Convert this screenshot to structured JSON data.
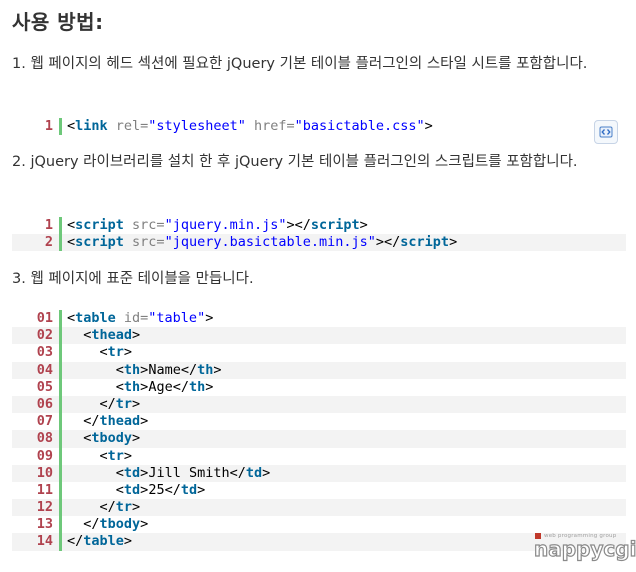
{
  "heading": "사용 방법:",
  "steps": [
    {
      "text": "1. 웹 페이지의 헤드 섹션에 필요한 jQuery 기본 테이블 플러그인의 스타일 시트를 포함합니다.",
      "lines": [
        {
          "num": "1",
          "tokens": [
            {
              "t": "<",
              "c": "tag-open"
            },
            {
              "t": "link",
              "c": "tagname"
            },
            {
              "t": " rel=",
              "c": "attr"
            },
            {
              "t": "\"stylesheet\"",
              "c": "str"
            },
            {
              "t": " href=",
              "c": "attr"
            },
            {
              "t": "\"basictable.css\"",
              "c": "str"
            },
            {
              "t": ">",
              "c": "tag-close"
            }
          ]
        }
      ]
    },
    {
      "text": "2. jQuery 라이브러리를 설치 한 후 jQuery 기본 테이블 플러그인의 스크립트를 포함합니다.",
      "lines": [
        {
          "num": "1",
          "tokens": [
            {
              "t": "<",
              "c": "tag-open"
            },
            {
              "t": "script",
              "c": "tagname"
            },
            {
              "t": " src=",
              "c": "attr"
            },
            {
              "t": "\"jquery.min.js\"",
              "c": "str"
            },
            {
              "t": "></",
              "c": "tag-close"
            },
            {
              "t": "script",
              "c": "tagname"
            },
            {
              "t": ">",
              "c": "tag-close"
            }
          ]
        },
        {
          "num": "2",
          "tokens": [
            {
              "t": "<",
              "c": "tag-open"
            },
            {
              "t": "script",
              "c": "tagname"
            },
            {
              "t": " src=",
              "c": "attr"
            },
            {
              "t": "\"jquery.basictable.min.js\"",
              "c": "str"
            },
            {
              "t": "></",
              "c": "tag-close"
            },
            {
              "t": "script",
              "c": "tagname"
            },
            {
              "t": ">",
              "c": "tag-close"
            }
          ]
        }
      ]
    },
    {
      "text": "3. 웹 페이지에 표준 테이블을 만듭니다.",
      "lines": [
        {
          "num": "01",
          "tokens": [
            {
              "t": "<",
              "c": "tag-open"
            },
            {
              "t": "table",
              "c": "tagname"
            },
            {
              "t": " id=",
              "c": "attr"
            },
            {
              "t": "\"table\"",
              "c": "str"
            },
            {
              "t": ">",
              "c": "tag-close"
            }
          ]
        },
        {
          "num": "02",
          "tokens": [
            {
              "t": "  <",
              "c": "tag-open"
            },
            {
              "t": "thead",
              "c": "tagname"
            },
            {
              "t": ">",
              "c": "tag-close"
            }
          ]
        },
        {
          "num": "03",
          "tokens": [
            {
              "t": "    <",
              "c": "tag-open"
            },
            {
              "t": "tr",
              "c": "tagname"
            },
            {
              "t": ">",
              "c": "tag-close"
            }
          ]
        },
        {
          "num": "04",
          "tokens": [
            {
              "t": "      <",
              "c": "tag-open"
            },
            {
              "t": "th",
              "c": "tagname"
            },
            {
              "t": ">",
              "c": "tag-close"
            },
            {
              "t": "Name",
              "c": "txt"
            },
            {
              "t": "</",
              "c": "tag-close"
            },
            {
              "t": "th",
              "c": "tagname"
            },
            {
              "t": ">",
              "c": "tag-close"
            }
          ]
        },
        {
          "num": "05",
          "tokens": [
            {
              "t": "      <",
              "c": "tag-open"
            },
            {
              "t": "th",
              "c": "tagname"
            },
            {
              "t": ">",
              "c": "tag-close"
            },
            {
              "t": "Age",
              "c": "txt"
            },
            {
              "t": "</",
              "c": "tag-close"
            },
            {
              "t": "th",
              "c": "tagname"
            },
            {
              "t": ">",
              "c": "tag-close"
            }
          ]
        },
        {
          "num": "06",
          "tokens": [
            {
              "t": "    </",
              "c": "tag-open"
            },
            {
              "t": "tr",
              "c": "tagname"
            },
            {
              "t": ">",
              "c": "tag-close"
            }
          ]
        },
        {
          "num": "07",
          "tokens": [
            {
              "t": "  </",
              "c": "tag-open"
            },
            {
              "t": "thead",
              "c": "tagname"
            },
            {
              "t": ">",
              "c": "tag-close"
            }
          ]
        },
        {
          "num": "08",
          "tokens": [
            {
              "t": "  <",
              "c": "tag-open"
            },
            {
              "t": "tbody",
              "c": "tagname"
            },
            {
              "t": ">",
              "c": "tag-close"
            }
          ]
        },
        {
          "num": "09",
          "tokens": [
            {
              "t": "    <",
              "c": "tag-open"
            },
            {
              "t": "tr",
              "c": "tagname"
            },
            {
              "t": ">",
              "c": "tag-close"
            }
          ]
        },
        {
          "num": "10",
          "tokens": [
            {
              "t": "      <",
              "c": "tag-open"
            },
            {
              "t": "td",
              "c": "tagname"
            },
            {
              "t": ">",
              "c": "tag-close"
            },
            {
              "t": "Jill Smith",
              "c": "txt"
            },
            {
              "t": "</",
              "c": "tag-close"
            },
            {
              "t": "td",
              "c": "tagname"
            },
            {
              "t": ">",
              "c": "tag-close"
            }
          ]
        },
        {
          "num": "11",
          "tokens": [
            {
              "t": "      <",
              "c": "tag-open"
            },
            {
              "t": "td",
              "c": "tagname"
            },
            {
              "t": ">",
              "c": "tag-close"
            },
            {
              "t": "25",
              "c": "txt"
            },
            {
              "t": "</",
              "c": "tag-close"
            },
            {
              "t": "td",
              "c": "tagname"
            },
            {
              "t": ">",
              "c": "tag-close"
            }
          ]
        },
        {
          "num": "12",
          "tokens": [
            {
              "t": "    </",
              "c": "tag-open"
            },
            {
              "t": "tr",
              "c": "tagname"
            },
            {
              "t": ">",
              "c": "tag-close"
            }
          ]
        },
        {
          "num": "13",
          "tokens": [
            {
              "t": "  </",
              "c": "tag-open"
            },
            {
              "t": "tbody",
              "c": "tagname"
            },
            {
              "t": ">",
              "c": "tag-close"
            }
          ]
        },
        {
          "num": "14",
          "tokens": [
            {
              "t": "</",
              "c": "tag-open"
            },
            {
              "t": "table",
              "c": "tagname"
            },
            {
              "t": ">",
              "c": "tag-close"
            }
          ]
        }
      ]
    }
  ],
  "view_source_icon": "view-source-icon",
  "logo": {
    "tagline": "web programming group",
    "wordmark": "nappycgi"
  },
  "colors": {
    "line_number": "#b0424e",
    "gutter_border": "#6ec87a",
    "tag_name": "#006699",
    "attribute": "#808080",
    "string": "#0000ff",
    "alt_row": "#f3f3f3"
  }
}
